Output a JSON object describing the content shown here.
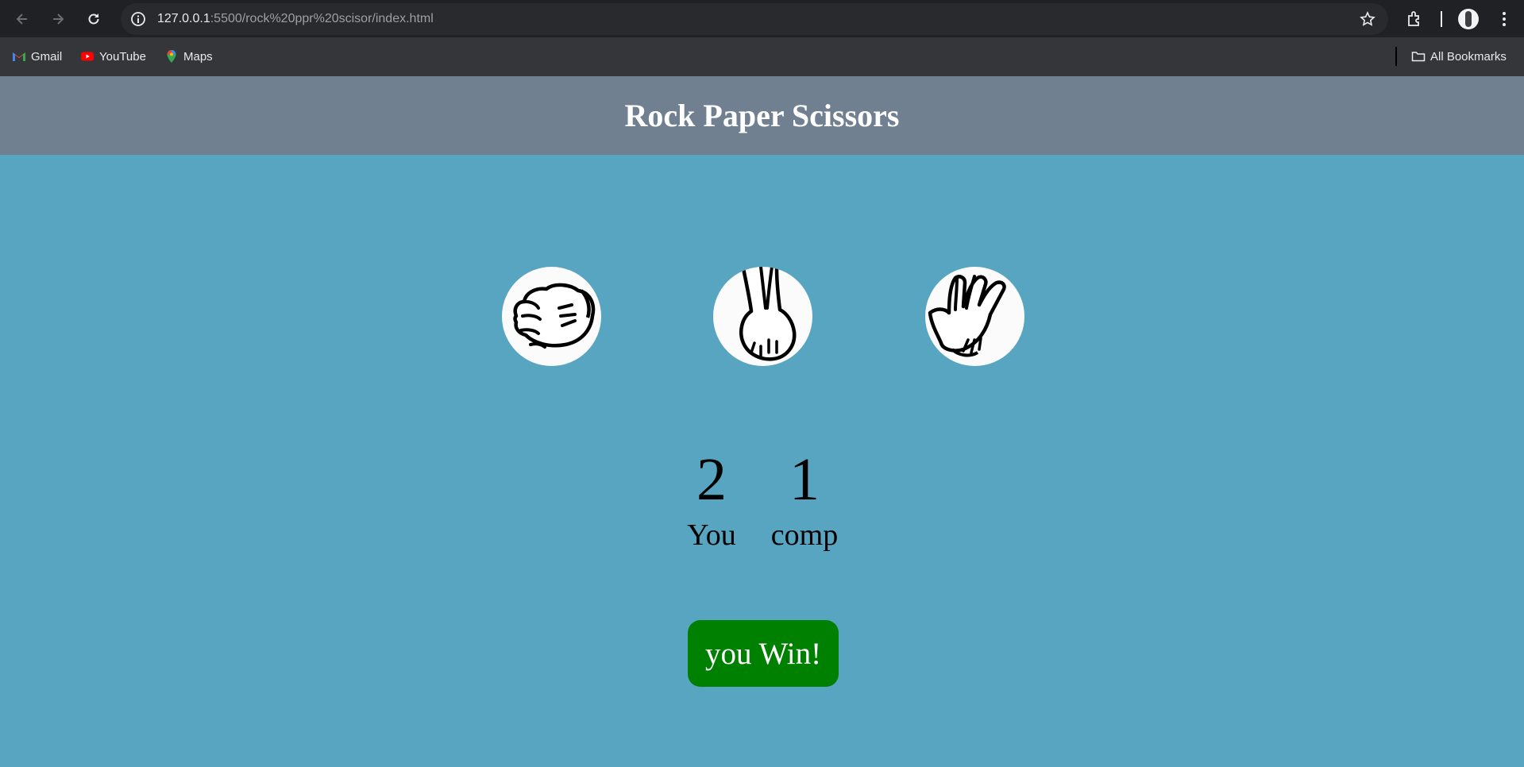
{
  "browser": {
    "url_host": "127.0.0.1",
    "url_path": ":5500/rock%20ppr%20scisor/index.html",
    "bookmarks": [
      {
        "label": "Gmail",
        "icon": "gmail-icon"
      },
      {
        "label": "YouTube",
        "icon": "youtube-icon"
      },
      {
        "label": "Maps",
        "icon": "maps-icon"
      }
    ],
    "all_bookmarks_label": "All Bookmarks",
    "colors": {
      "toolbar": "#202124",
      "omnibox": "#282a2d",
      "bookmarks_bar": "#35363a"
    }
  },
  "page": {
    "title": "Rock Paper Scissors",
    "choices": [
      {
        "id": "rock",
        "icon": "rock-hand-icon"
      },
      {
        "id": "paper",
        "icon": "paper-hand-icon"
      },
      {
        "id": "scissors",
        "icon": "scissors-hand-icon"
      }
    ],
    "scores": {
      "user": {
        "value": "2",
        "label": "You"
      },
      "comp": {
        "value": "1",
        "label": "comp"
      }
    },
    "message": "you Win!",
    "colors": {
      "background": "#58a5c1",
      "header": "#708090",
      "message_bg": "#008000",
      "title_text": "#ffffff"
    }
  }
}
